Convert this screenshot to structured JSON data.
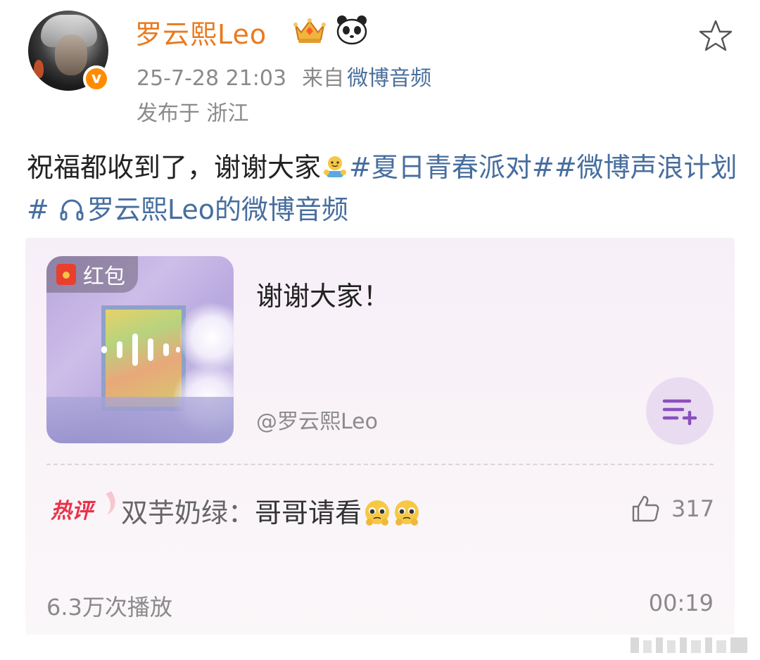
{
  "user": {
    "name": "罗云熙Leo",
    "verified_mark": "v",
    "badges": [
      "crown-icon",
      "panda-icon"
    ]
  },
  "meta": {
    "timestamp": "25-7-28 21:03",
    "from_label": "来自",
    "source": "微博音频",
    "location": "发布于 浙江"
  },
  "post": {
    "text": "祝福都收到了，谢谢大家",
    "tags": [
      "#夏日青春派对#",
      "#微博声浪计划#"
    ],
    "link": "罗云熙Leo的微博音频"
  },
  "audio_card": {
    "badge": "红包",
    "title": "谢谢大家！",
    "author": "@罗云熙Leo",
    "hot_label": "热评",
    "hot_comment_user": "双芋奶绿：",
    "hot_comment_text": "哥哥请看",
    "likes": "317",
    "plays": "6.3万次播放",
    "duration": "00:19"
  },
  "colors": {
    "username": "#ea7a1e",
    "link": "#476e9e",
    "card_bg": "#f7eff8",
    "accent_purple": "#8b4fbf"
  }
}
